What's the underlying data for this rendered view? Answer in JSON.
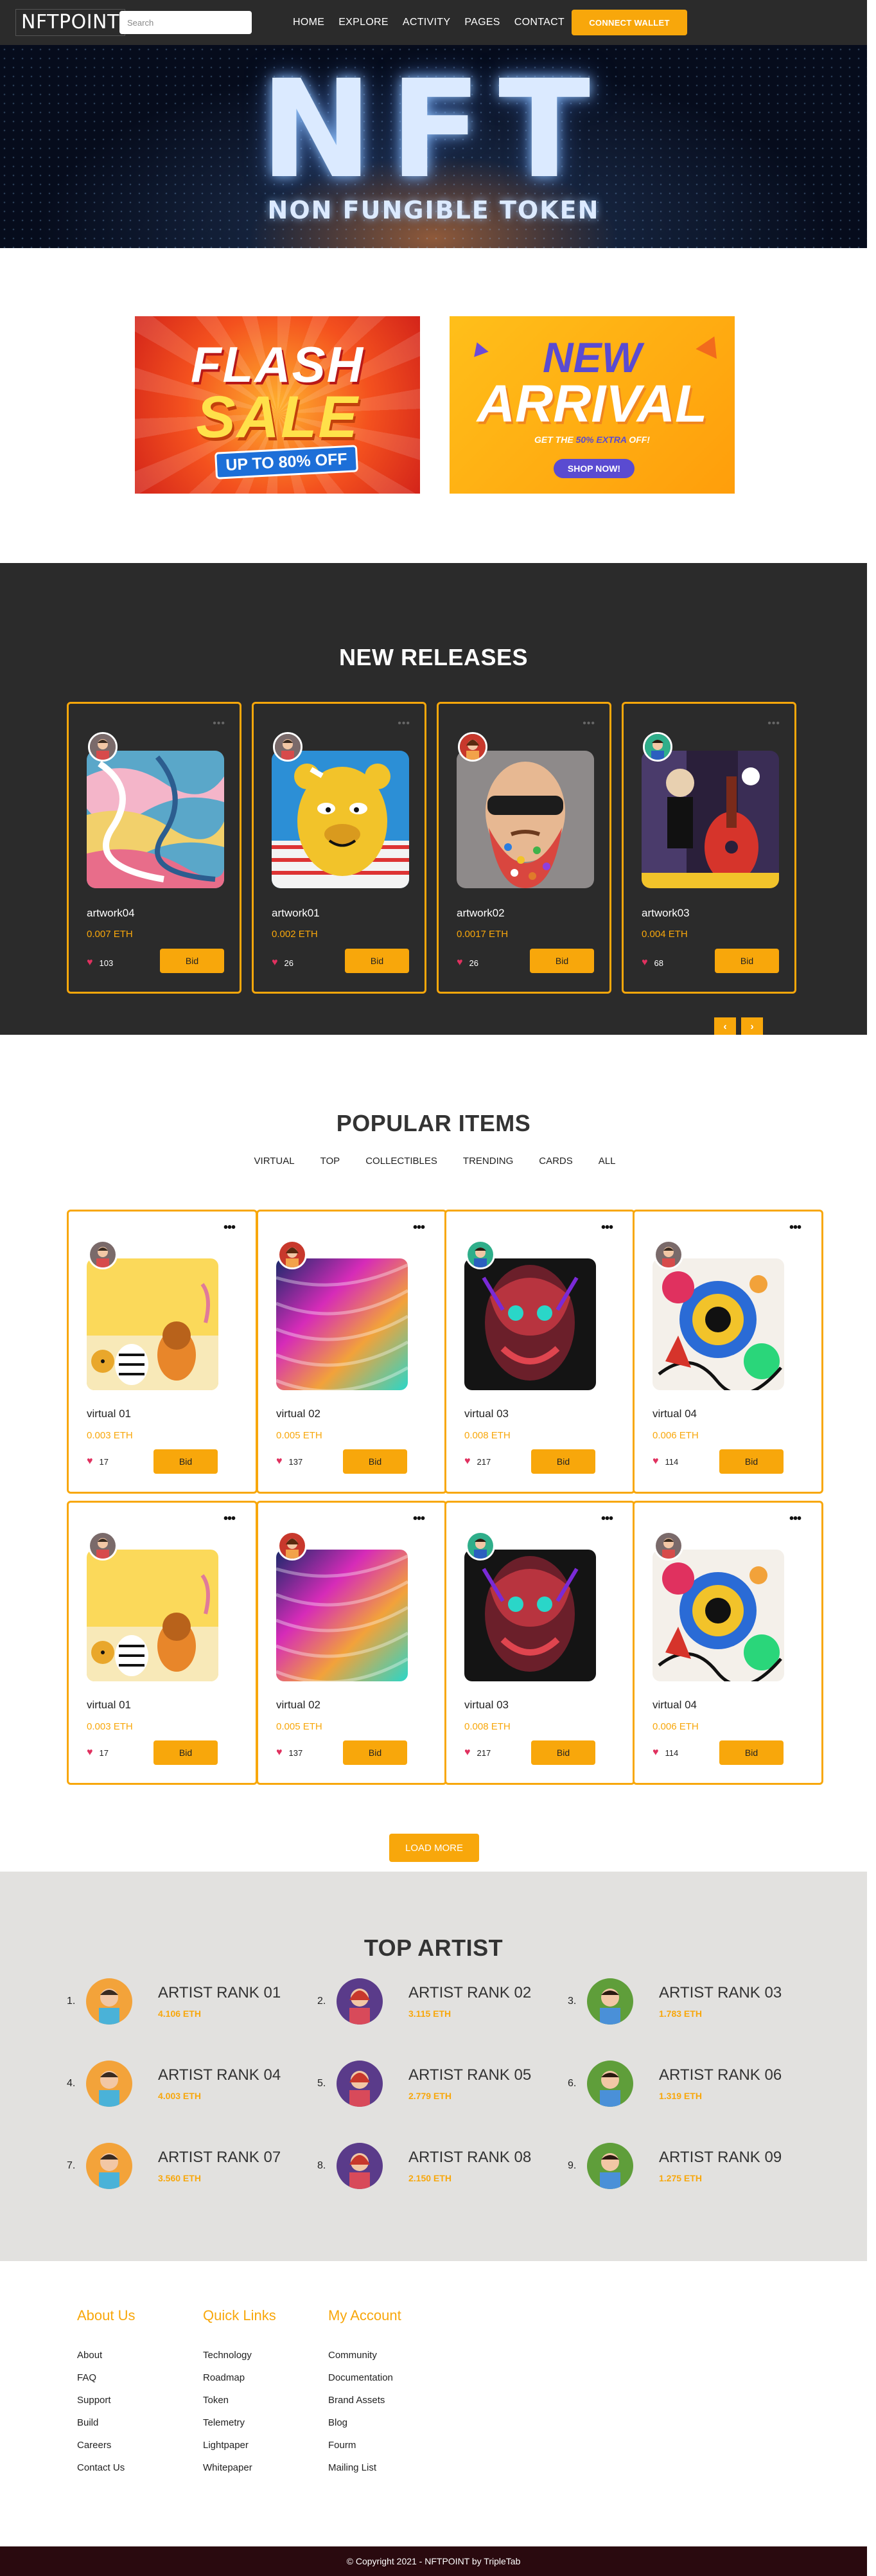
{
  "nav": {
    "logo": "NFTPOINT",
    "search_placeholder": "Search",
    "links": [
      "HOME",
      "EXPLORE",
      "ACTIVITY",
      "PAGES",
      "CONTACT"
    ],
    "wallet_label": "CONNECT WALLET"
  },
  "hero": {
    "title": "NFT",
    "subtitle": "NON FUNGIBLE TOKEN"
  },
  "banners": {
    "flash": {
      "line1": "FLASH",
      "line2": "SALE",
      "tag": "UP TO 80% OFF"
    },
    "arrival": {
      "line1": "NEW",
      "line2": "ARRIVAL",
      "sub_a": "GET THE ",
      "sub_hl": "50% EXTRA",
      "sub_b": " OFF!",
      "cta": "SHOP NOW!"
    }
  },
  "releases": {
    "title": "NEW RELEASES",
    "items": [
      {
        "name": "artwork04",
        "price": "0.007 ETH",
        "likes": "103",
        "bid": "Bid"
      },
      {
        "name": "artwork01",
        "price": "0.002 ETH",
        "likes": "26",
        "bid": "Bid"
      },
      {
        "name": "artwork02",
        "price": "0.0017 ETH",
        "likes": "26",
        "bid": "Bid"
      },
      {
        "name": "artwork03",
        "price": "0.004 ETH",
        "likes": "68",
        "bid": "Bid"
      }
    ],
    "prev": "‹",
    "next": "›"
  },
  "popular": {
    "title": "POPULAR ITEMS",
    "filters": [
      "VIRTUAL",
      "TOP",
      "COLLECTIBLES",
      "TRENDING",
      "CARDS",
      "ALL"
    ],
    "items": [
      {
        "name": "virtual 01",
        "price": "0.003 ETH",
        "likes": "17",
        "bid": "Bid"
      },
      {
        "name": "virtual 02",
        "price": "0.005 ETH",
        "likes": "137",
        "bid": "Bid"
      },
      {
        "name": "virtual 03",
        "price": "0.008 ETH",
        "likes": "217",
        "bid": "Bid"
      },
      {
        "name": "virtual 04",
        "price": "0.006 ETH",
        "likes": "114",
        "bid": "Bid"
      },
      {
        "name": "virtual 01",
        "price": "0.003 ETH",
        "likes": "17",
        "bid": "Bid"
      },
      {
        "name": "virtual 02",
        "price": "0.005 ETH",
        "likes": "137",
        "bid": "Bid"
      },
      {
        "name": "virtual 03",
        "price": "0.008 ETH",
        "likes": "217",
        "bid": "Bid"
      },
      {
        "name": "virtual 04",
        "price": "0.006 ETH",
        "likes": "114",
        "bid": "Bid"
      }
    ],
    "load_more": "LOAD MORE"
  },
  "artists": {
    "title": "TOP ARTIST",
    "items": [
      {
        "rank": "1.",
        "name": "ARTIST RANK 01",
        "eth": "4.106 ETH"
      },
      {
        "rank": "2.",
        "name": "ARTIST RANK 02",
        "eth": "3.115 ETH"
      },
      {
        "rank": "3.",
        "name": "ARTIST RANK 03",
        "eth": "1.783 ETH"
      },
      {
        "rank": "4.",
        "name": "ARTIST RANK 04",
        "eth": "4.003 ETH"
      },
      {
        "rank": "5.",
        "name": "ARTIST RANK 05",
        "eth": "2.779 ETH"
      },
      {
        "rank": "6.",
        "name": "ARTIST RANK 06",
        "eth": "1.319 ETH"
      },
      {
        "rank": "7.",
        "name": "ARTIST RANK 07",
        "eth": "3.560 ETH"
      },
      {
        "rank": "8.",
        "name": "ARTIST RANK 08",
        "eth": "2.150 ETH"
      },
      {
        "rank": "9.",
        "name": "ARTIST RANK 09",
        "eth": "1.275 ETH"
      }
    ]
  },
  "footer": {
    "columns": [
      {
        "title": "About Us",
        "links": [
          "About",
          "FAQ",
          "Support",
          "Build",
          "Careers",
          "Contact Us"
        ]
      },
      {
        "title": "Quick Links",
        "links": [
          "Technology",
          "Roadmap",
          "Token",
          "Telemetry",
          "Lightpaper",
          "Whitepaper"
        ]
      },
      {
        "title": "My Account",
        "links": [
          "Community",
          "Documentation",
          "Brand Assets",
          "Blog",
          "Fourm",
          "Mailing List"
        ]
      }
    ],
    "copyright": "© Copyright 2021 - NFTPOINT by TripleTab"
  },
  "colors": {
    "accent": "#f8a70b",
    "dark": "#2b2b2b",
    "heart": "#e0315f",
    "artist_bg": "#e2e1df"
  }
}
